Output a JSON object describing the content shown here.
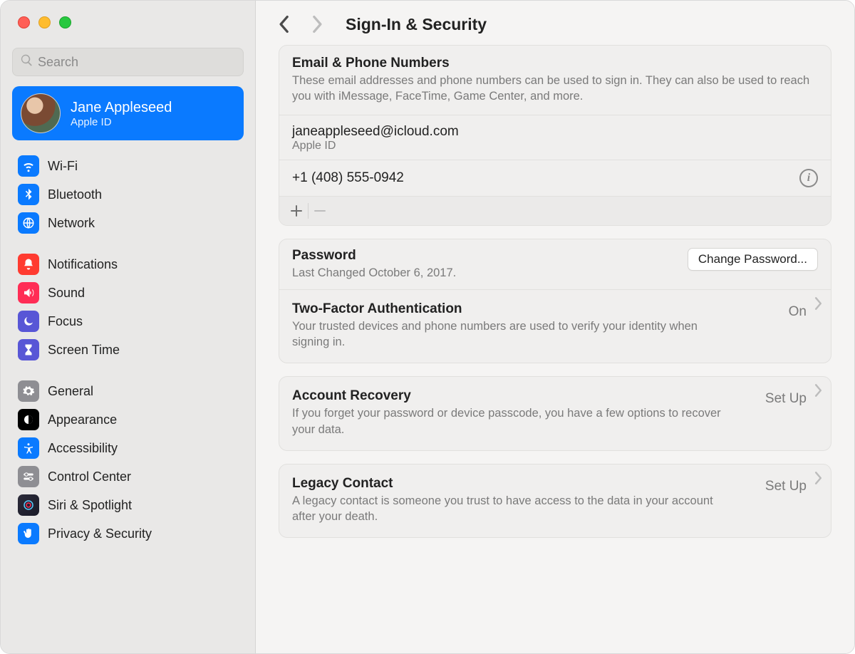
{
  "search": {
    "placeholder": "Search"
  },
  "profile": {
    "name": "Jane Appleseed",
    "subtitle": "Apple ID"
  },
  "sidebar": {
    "groups": [
      [
        {
          "label": "Wi-Fi",
          "color": "#0a7aff",
          "icon": "wifi"
        },
        {
          "label": "Bluetooth",
          "color": "#0a7aff",
          "icon": "bluetooth"
        },
        {
          "label": "Network",
          "color": "#0a7aff",
          "icon": "globe"
        }
      ],
      [
        {
          "label": "Notifications",
          "color": "#ff3b30",
          "icon": "bell"
        },
        {
          "label": "Sound",
          "color": "#ff2d55",
          "icon": "speaker"
        },
        {
          "label": "Focus",
          "color": "#5856d6",
          "icon": "moon"
        },
        {
          "label": "Screen Time",
          "color": "#5856d6",
          "icon": "hourglass"
        }
      ],
      [
        {
          "label": "General",
          "color": "#8e8e93",
          "icon": "gear"
        },
        {
          "label": "Appearance",
          "color": "#000000",
          "icon": "appearance"
        },
        {
          "label": "Accessibility",
          "color": "#0a7aff",
          "icon": "accessibility"
        },
        {
          "label": "Control Center",
          "color": "#8e8e93",
          "icon": "sliders"
        },
        {
          "label": "Siri & Spotlight",
          "color": "gradient",
          "icon": "siri"
        },
        {
          "label": "Privacy & Security",
          "color": "#0a7aff",
          "icon": "hand"
        }
      ]
    ]
  },
  "page": {
    "title": "Sign-In & Security"
  },
  "email_phone": {
    "title": "Email & Phone Numbers",
    "desc": "These email addresses and phone numbers can be used to sign in. They can also be used to reach you with iMessage, FaceTime, Game Center, and more.",
    "items": [
      {
        "value": "janeappleseed@icloud.com",
        "sub": "Apple ID"
      },
      {
        "value": "+1 (408) 555-0942"
      }
    ]
  },
  "password": {
    "title": "Password",
    "desc": "Last Changed October 6, 2017.",
    "button": "Change Password..."
  },
  "twofa": {
    "title": "Two-Factor Authentication",
    "status": "On",
    "desc": "Your trusted devices and phone numbers are used to verify your identity when signing in."
  },
  "recovery": {
    "title": "Account Recovery",
    "status": "Set Up",
    "desc": "If you forget your password or device passcode, you have a few options to recover your data."
  },
  "legacy": {
    "title": "Legacy Contact",
    "status": "Set Up",
    "desc": "A legacy contact is someone you trust to have access to the data in your account after your death."
  }
}
